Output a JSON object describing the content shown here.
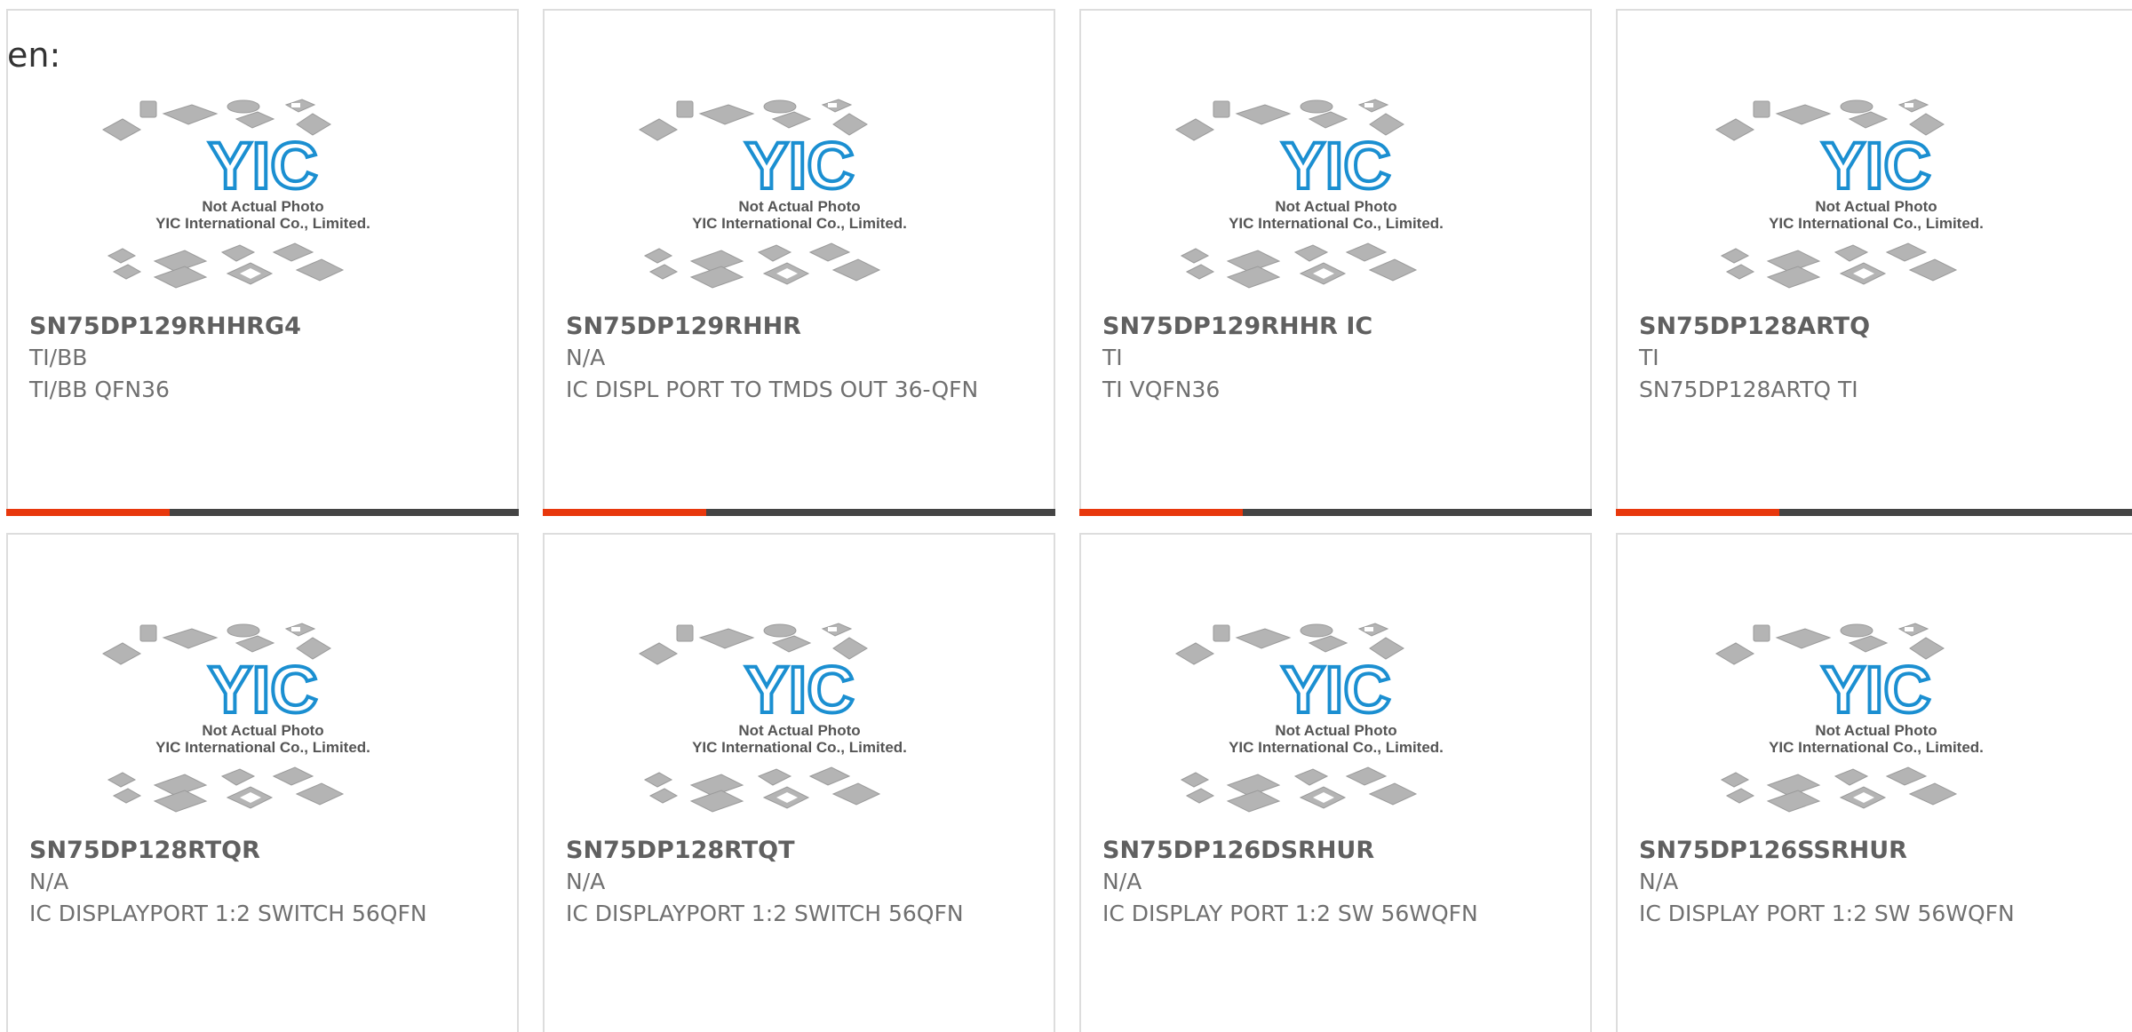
{
  "page": {
    "lang_label": "en:"
  },
  "thumbnail": {
    "logo_text": "YIC",
    "line1": "Not Actual Photo",
    "line2": "YIC International Co., Limited.",
    "logo_color": "#1b8fd1",
    "chip_color": "#b4b4b4"
  },
  "colors": {
    "accent_bar": "#e8380d",
    "base_bar": "#444444",
    "title_text": "#606060",
    "body_text": "#707070",
    "card_border": "#dddddd"
  },
  "products": [
    {
      "part": "SN75DP129RHHRG4",
      "brand": "TI/BB",
      "desc": "TI/BB QFN36"
    },
    {
      "part": "SN75DP129RHHR",
      "brand": "N/A",
      "desc": "IC DISPL PORT TO TMDS OUT 36-QFN"
    },
    {
      "part": "SN75DP129RHHR IC",
      "brand": "TI",
      "desc": "TI VQFN36"
    },
    {
      "part": "SN75DP128ARTQ",
      "brand": "TI",
      "desc": "SN75DP128ARTQ TI"
    },
    {
      "part": "SN75DP128RTQR",
      "brand": "N/A",
      "desc": "IC DISPLAYPORT 1:2 SWITCH 56QFN"
    },
    {
      "part": "SN75DP128RTQT",
      "brand": "N/A",
      "desc": "IC DISPLAYPORT 1:2 SWITCH 56QFN"
    },
    {
      "part": "SN75DP126DSRHUR",
      "brand": "N/A",
      "desc": "IC DISPLAY PORT 1:2 SW 56WQFN"
    },
    {
      "part": "SN75DP126SSRHUR",
      "brand": "N/A",
      "desc": "IC DISPLAY PORT 1:2 SW 56WQFN"
    }
  ]
}
